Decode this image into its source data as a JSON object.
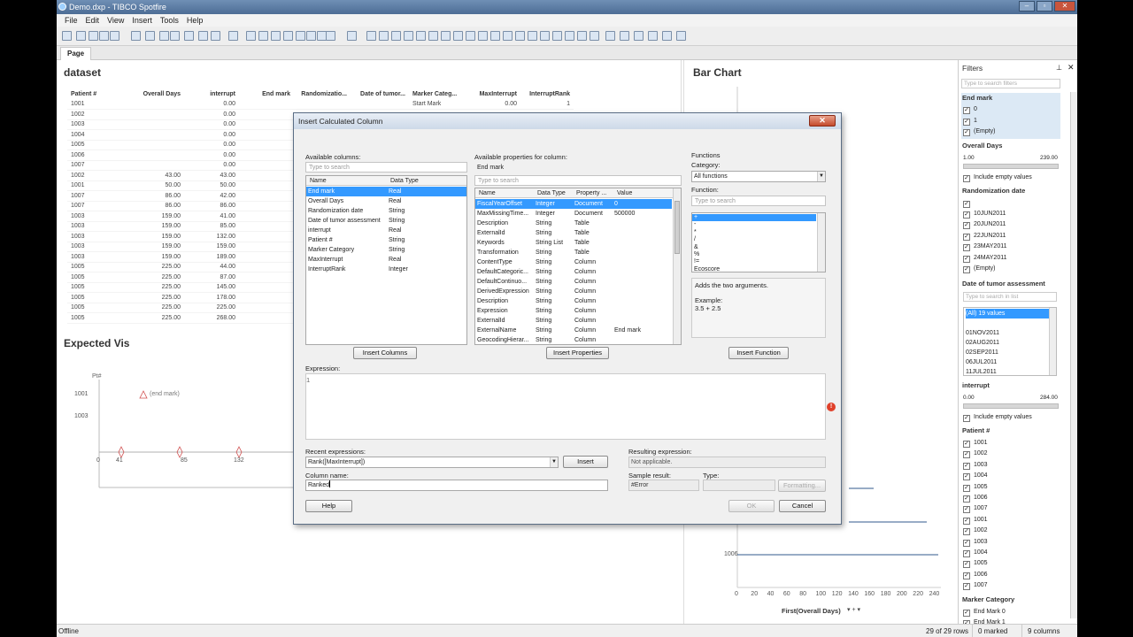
{
  "window": {
    "title": "Demo.dxp - TIBCO Spotfire"
  },
  "menu": [
    "File",
    "Edit",
    "View",
    "Insert",
    "Tools",
    "Help"
  ],
  "tabs": {
    "page": "Page"
  },
  "dataset": {
    "title": "dataset",
    "columns": [
      "Patient #",
      "Overall Days",
      "interrupt",
      "End mark",
      "Randomizatio...",
      "Date of tumor...",
      "Marker Categ...",
      "MaxInterrupt",
      "InterruptRank"
    ],
    "rows": [
      [
        "1001",
        "",
        "0.00",
        "",
        "",
        "",
        "Start Mark",
        "0.00",
        "1"
      ],
      [
        "1002",
        "",
        "0.00",
        "",
        "",
        "",
        "",
        "",
        ""
      ],
      [
        "1003",
        "",
        "0.00",
        "",
        "",
        "",
        "",
        "",
        ""
      ],
      [
        "1004",
        "",
        "0.00",
        "",
        "",
        "",
        "",
        "",
        ""
      ],
      [
        "1005",
        "",
        "0.00",
        "",
        "",
        "",
        "",
        "",
        ""
      ],
      [
        "1006",
        "",
        "0.00",
        "",
        "",
        "",
        "",
        "",
        ""
      ],
      [
        "1007",
        "",
        "0.00",
        "",
        "",
        "",
        "",
        "",
        ""
      ],
      [
        "1002",
        "43.00",
        "43.00",
        "",
        "",
        "",
        "",
        "",
        ""
      ],
      [
        "1001",
        "50.00",
        "50.00",
        "",
        "",
        "",
        "",
        "",
        ""
      ],
      [
        "1007",
        "86.00",
        "42.00",
        "",
        "",
        "",
        "",
        "",
        ""
      ],
      [
        "1007",
        "86.00",
        "86.00",
        "",
        "",
        "",
        "",
        "",
        ""
      ],
      [
        "1003",
        "159.00",
        "41.00",
        "",
        "",
        "",
        "",
        "",
        ""
      ],
      [
        "1003",
        "159.00",
        "85.00",
        "",
        "",
        "",
        "",
        "",
        ""
      ],
      [
        "1003",
        "159.00",
        "132.00",
        "",
        "",
        "",
        "",
        "",
        ""
      ],
      [
        "1003",
        "159.00",
        "159.00",
        "",
        "",
        "",
        "",
        "",
        ""
      ],
      [
        "1003",
        "159.00",
        "189.00",
        "",
        "",
        "",
        "",
        "",
        ""
      ],
      [
        "1005",
        "225.00",
        "44.00",
        "",
        "",
        "",
        "",
        "",
        ""
      ],
      [
        "1005",
        "225.00",
        "87.00",
        "",
        "",
        "",
        "",
        "",
        ""
      ],
      [
        "1005",
        "225.00",
        "145.00",
        "",
        "",
        "",
        "",
        "",
        ""
      ],
      [
        "1005",
        "225.00",
        "178.00",
        "",
        "",
        "",
        "",
        "",
        ""
      ],
      [
        "1005",
        "225.00",
        "225.00",
        "",
        "",
        "",
        "",
        "",
        ""
      ],
      [
        "1005",
        "225.00",
        "268.00",
        "",
        "",
        "",
        "",
        "",
        ""
      ]
    ]
  },
  "expected_vis": {
    "title": "Expected Vis",
    "y_axis_label": "Pt#",
    "y_ticks": [
      "1001",
      "1003"
    ],
    "x_ticks": [
      "0",
      "41",
      "85",
      "132"
    ],
    "annotation": "(end mark)"
  },
  "bar_chart": {
    "title": "Bar Chart",
    "y_tick": "1006",
    "x_ticks": [
      "0",
      "20",
      "40",
      "60",
      "80",
      "100",
      "120",
      "140",
      "160",
      "180",
      "200",
      "220",
      "240"
    ],
    "x_axis_label": "First(Overall Days)"
  },
  "filters": {
    "title": "Filters",
    "search_placeholder": "Type to search filters",
    "end_mark": {
      "label": "End mark",
      "items": [
        "0",
        "1",
        "(Empty)"
      ]
    },
    "overall_days": {
      "label": "Overall Days",
      "min": "1.00",
      "max": "239.00",
      "include_empty": "Include empty values"
    },
    "randomization_date": {
      "label": "Randomization date",
      "items": [
        "10JUN2011",
        "20JUN2011",
        "22JUN2011",
        "23MAY2011",
        "24MAY2011",
        "(Empty)"
      ]
    },
    "date_tumor": {
      "label": "Date of tumor assessment",
      "search_placeholder": "Type to search in list",
      "items": [
        "(All) 19 values",
        "",
        "01NOV2011",
        "02AUG2011",
        "02SEP2011",
        "06JUL2011",
        "11JUL2011"
      ]
    },
    "interrupt": {
      "label": "interrupt",
      "min": "0.00",
      "max": "284.00",
      "include_empty": "Include empty values"
    },
    "patient": {
      "label": "Patient #",
      "items": [
        "1001",
        "1002",
        "1003",
        "1004",
        "1005",
        "1006",
        "1007",
        "1001",
        "1002",
        "1003",
        "1004",
        "1005",
        "1006",
        "1007"
      ]
    },
    "marker_category": {
      "label": "Marker Category",
      "items": [
        "End Mark 0",
        "End Mark 1"
      ]
    }
  },
  "status": {
    "left": "Offline",
    "rows": "29 of 29 rows",
    "marked": "0 marked",
    "columns": "9 columns"
  },
  "dialog": {
    "title": "Insert Calculated Column",
    "close": "✕",
    "available_columns_label": "Available columns:",
    "search_placeholder": "Type to search",
    "col_headers": [
      "Name",
      "Data Type"
    ],
    "columns": [
      [
        "End mark",
        "Real"
      ],
      [
        "Overall Days",
        "Real"
      ],
      [
        "Randomization date",
        "String"
      ],
      [
        "Date of tumor assessment",
        "String"
      ],
      [
        "interrupt",
        "Real"
      ],
      [
        "Patient #",
        "String"
      ],
      [
        "Marker Category",
        "String"
      ],
      [
        "MaxInterrupt",
        "Real"
      ],
      [
        "InterruptRank",
        "Integer"
      ]
    ],
    "insert_columns": "Insert Columns",
    "available_props_label": "Available properties for column:",
    "selected_column": "End mark",
    "prop_headers": [
      "Name",
      "Data Type",
      "Property ...",
      "Value"
    ],
    "properties": [
      [
        "FiscalYearOffset",
        "Integer",
        "Document",
        "0"
      ],
      [
        "MaxMissingTime...",
        "Integer",
        "Document",
        "500000"
      ],
      [
        "Description",
        "String",
        "Table",
        ""
      ],
      [
        "ExternalId",
        "String",
        "Table",
        ""
      ],
      [
        "Keywords",
        "String List",
        "Table",
        ""
      ],
      [
        "Transformation",
        "String",
        "Table",
        ""
      ],
      [
        "ContentType",
        "String",
        "Column",
        ""
      ],
      [
        "DefaultCategoric...",
        "String",
        "Column",
        ""
      ],
      [
        "DefaultContinuo...",
        "String",
        "Column",
        ""
      ],
      [
        "DerivedExpression",
        "String",
        "Column",
        ""
      ],
      [
        "Description",
        "String",
        "Column",
        ""
      ],
      [
        "Expression",
        "String",
        "Column",
        ""
      ],
      [
        "ExternalId",
        "String",
        "Column",
        ""
      ],
      [
        "ExternalName",
        "String",
        "Column",
        "End mark"
      ],
      [
        "GeocodingHierar...",
        "String",
        "Column",
        ""
      ]
    ],
    "insert_properties": "Insert Properties",
    "functions_label": "Functions",
    "category_label": "Category:",
    "category_value": "All functions",
    "function_label": "Function:",
    "functions": [
      "+",
      "-",
      "*",
      "/",
      "&",
      "%",
      "!=",
      "Ecoscore"
    ],
    "function_desc": "Adds the two arguments.",
    "example_label": "Example:",
    "example_value": "3.5 + 2.5",
    "insert_function": "Insert Function",
    "expression_label": "Expression:",
    "expression_line": "1",
    "recent_label": "Recent expressions:",
    "recent_value": "Rank([MaxInterrupt])",
    "insert": "Insert",
    "column_name_label": "Column name:",
    "column_name_value": "Ranked",
    "resulting_label": "Resulting expression:",
    "resulting_value": "Not applicable.",
    "sample_label": "Sample result:",
    "sample_value": "#Error",
    "type_label": "Type:",
    "formatting": "Formatting...",
    "help": "Help",
    "ok": "OK",
    "cancel": "Cancel"
  },
  "colors": {
    "selection": "#3399ff",
    "titlebar": "#5a7aa3",
    "error": "#e0402a"
  }
}
